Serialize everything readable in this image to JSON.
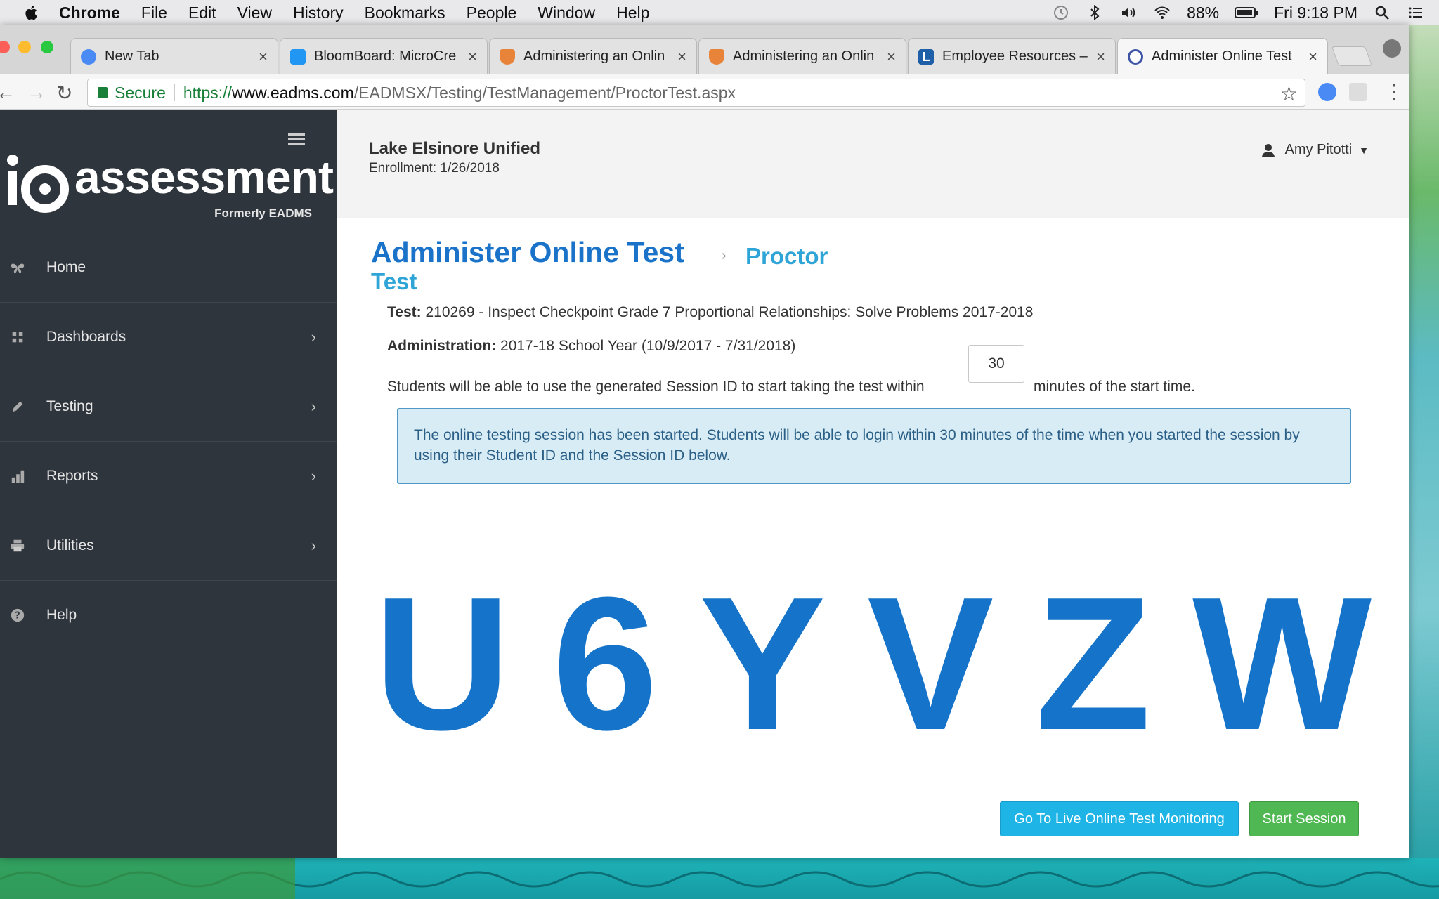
{
  "menubar": {
    "app": "Chrome",
    "items": [
      "File",
      "Edit",
      "View",
      "History",
      "Bookmarks",
      "People",
      "Window",
      "Help"
    ],
    "battery": "88%",
    "clock": "Fri 9:18 PM"
  },
  "tabs": [
    {
      "title": "New Tab",
      "icon": "search-icon"
    },
    {
      "title": "BloomBoard: MicroCre",
      "icon": "bloomboard-icon"
    },
    {
      "title": "Administering an Onlin",
      "icon": "shield-icon"
    },
    {
      "title": "Administering an Onlin",
      "icon": "shield-icon"
    },
    {
      "title": "Employee Resources –",
      "icon": "letter-l-icon"
    },
    {
      "title": "Administer Online Test",
      "icon": "io-icon"
    }
  ],
  "address": {
    "secure_label": "Secure",
    "scheme": "https://",
    "host": "www.eadms.com",
    "path": "/EADMSX/Testing/TestManagement/ProctorTest.aspx"
  },
  "sidebar": {
    "brand": "assessment",
    "brand_sub": "Formerly EADMS",
    "items": [
      {
        "label": "Home",
        "icon": "butterfly-icon",
        "chevron": false
      },
      {
        "label": "Dashboards",
        "icon": "dashboard-grid-icon",
        "chevron": true
      },
      {
        "label": "Testing",
        "icon": "pencil-icon",
        "chevron": true
      },
      {
        "label": "Reports",
        "icon": "bar-chart-icon",
        "chevron": true
      },
      {
        "label": "Utilities",
        "icon": "printer-icon",
        "chevron": true
      },
      {
        "label": "Help",
        "icon": "question-circle-icon",
        "chevron": false
      }
    ]
  },
  "header": {
    "district": "Lake Elsinore Unified",
    "enrollment": "Enrollment: 1/26/2018",
    "user": "Amy Pitotti"
  },
  "main": {
    "title": "Administer Online Test",
    "crumb_1": "Proctor",
    "crumb_2": "Test",
    "test_label": "Test:",
    "test_value": "210269 - Inspect Checkpoint Grade 7 Proportional Relationships: Solve Problems 2017-2018",
    "admin_label": "Administration:",
    "admin_value": "2017-18 School Year (10/9/2017 - 7/31/2018)",
    "minutes_prefix": "Students will be able to use the generated Session ID to start taking the test within",
    "minutes_value": "30",
    "minutes_suffix": "minutes of the start time.",
    "alert": "The online testing session has been started. Students will be able to login within 30 minutes of the time when you started the session by using their Student ID and the Session ID below.",
    "session_chars": [
      "U",
      "6",
      "Y",
      "V",
      "Z",
      "W"
    ],
    "live_button": "Go To Live Online Test Monitoring",
    "start_button": "Start Session"
  },
  "colors": {
    "brand_blue": "#1a73c9",
    "crumb_blue": "#2fa4d7",
    "sidebar_bg": "#2f353d",
    "alert_bg": "#d8ecf6",
    "live_button": "#1fb4e6",
    "start_button": "#50b852"
  }
}
